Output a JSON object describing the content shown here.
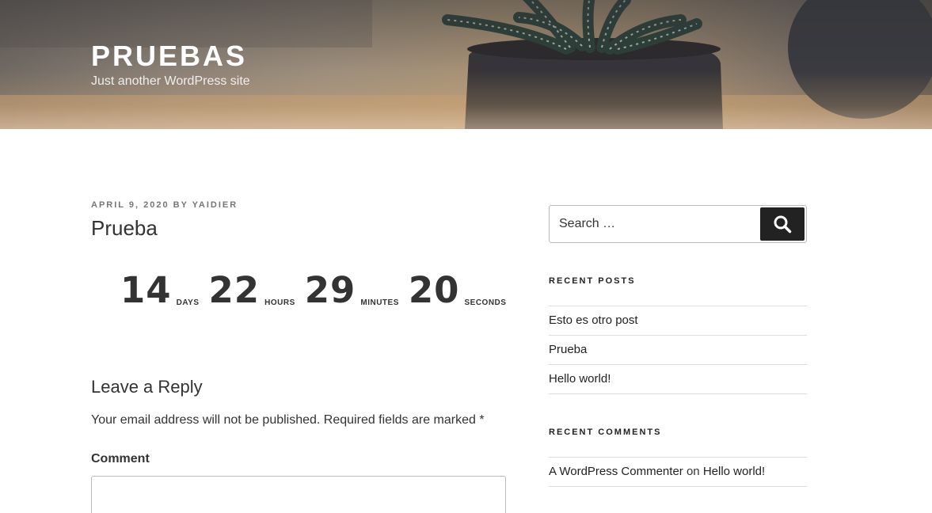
{
  "header": {
    "site_title": "PRUEBAS",
    "site_description": "Just another WordPress site"
  },
  "post": {
    "date": "APRIL 9, 2020",
    "by": "BY",
    "author": "YAIDIER",
    "title": "Prueba"
  },
  "countdown": {
    "days": "14",
    "days_label": "DAYS",
    "hours": "22",
    "hours_label": "HOURS",
    "minutes": "29",
    "minutes_label": "MINUTES",
    "seconds": "20",
    "seconds_label": "SECONDS"
  },
  "comment_form": {
    "title": "Leave a Reply",
    "notes": "Your email address will not be published. Required fields are marked *",
    "comment_label": "Comment"
  },
  "sidebar": {
    "search_placeholder": "Search …",
    "recent_posts_title": "RECENT POSTS",
    "recent_posts": [
      "Esto es otro post",
      "Prueba",
      "Hello world!"
    ],
    "recent_comments_title": "RECENT COMMENTS",
    "recent_comments": [
      {
        "author": "A WordPress Commenter",
        "on": "on",
        "post": "Hello world!"
      }
    ]
  },
  "colors": {
    "text": "#333333",
    "meta": "#767676",
    "search_button": "#222222",
    "border": "#dddddd"
  }
}
